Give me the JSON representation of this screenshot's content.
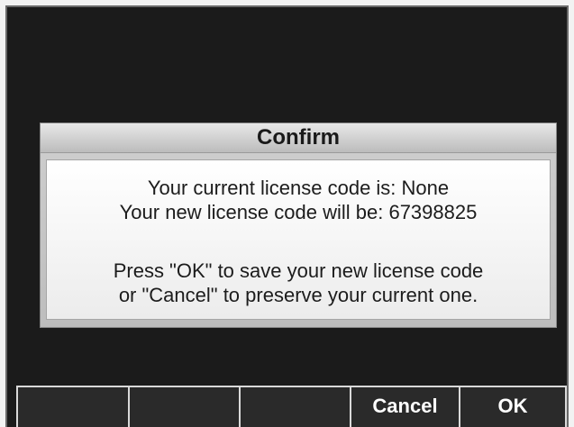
{
  "dialog": {
    "title": "Confirm",
    "lines": [
      "Your current license code is: None",
      "Your new license code will be: 67398825",
      "Press \"OK\" to save your new license code",
      "or \"Cancel\" to preserve your current one."
    ]
  },
  "softkeys": [
    {
      "label": ""
    },
    {
      "label": ""
    },
    {
      "label": ""
    },
    {
      "label": "Cancel"
    },
    {
      "label": "OK"
    }
  ]
}
